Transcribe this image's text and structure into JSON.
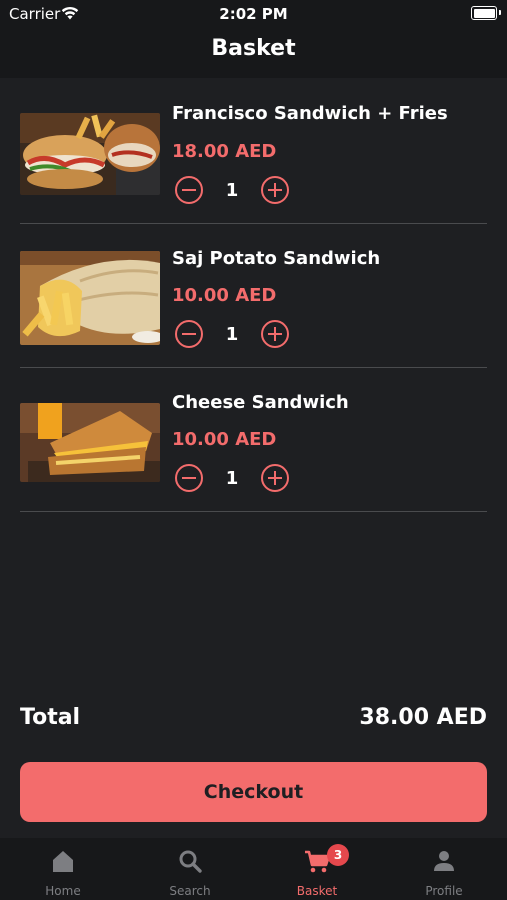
{
  "status_bar": {
    "carrier": "Carrier",
    "time": "2:02 PM"
  },
  "header": {
    "title": "Basket"
  },
  "items": [
    {
      "name": "Francisco Sandwich + Fries",
      "price": "18.00 AED",
      "quantity": "1",
      "image_icon": "sandwich-fries-photo"
    },
    {
      "name": "Saj Potato Sandwich",
      "price": "10.00 AED",
      "quantity": "1",
      "image_icon": "saj-potato-photo"
    },
    {
      "name": "Cheese Sandwich",
      "price": "10.00 AED",
      "quantity": "1",
      "image_icon": "cheese-sandwich-photo"
    }
  ],
  "summary": {
    "total_label": "Total",
    "total_value": "38.00 AED"
  },
  "checkout": {
    "label": "Checkout"
  },
  "tabs": [
    {
      "label": "Home",
      "icon": "home-icon"
    },
    {
      "label": "Search",
      "icon": "search-icon"
    },
    {
      "label": "Basket",
      "icon": "cart-icon",
      "badge": "3",
      "active": true
    },
    {
      "label": "Profile",
      "icon": "profile-icon"
    }
  ],
  "colors": {
    "accent": "#f36c6c",
    "background": "#1e1f22",
    "bar": "#17181a",
    "badge": "#e5484d"
  }
}
